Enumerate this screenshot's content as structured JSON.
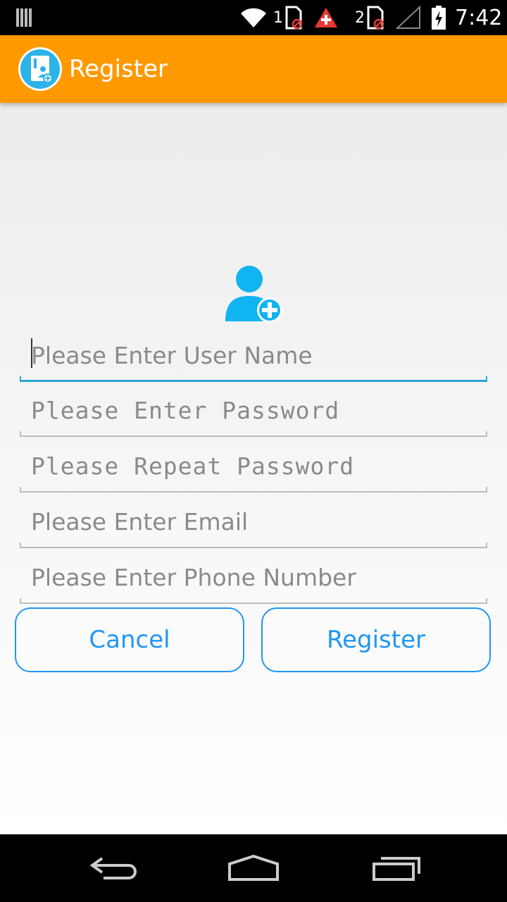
{
  "status_bar": {
    "sim1_label": "1",
    "sim2_label": "2",
    "time": "7:42",
    "icons": [
      "notification-icon",
      "wifi-icon",
      "sim1-icon",
      "alert-icon",
      "sim2-icon",
      "signal-icon",
      "battery-icon"
    ]
  },
  "app_bar": {
    "title": "Register",
    "icon": "app-logo-icon",
    "color": "#ff9900"
  },
  "form": {
    "avatar_icon": "add-user-icon",
    "username_placeholder": "Please Enter User Name",
    "password_placeholder": "Please Enter Password",
    "repeat_password_placeholder": "Please Repeat Password",
    "email_placeholder": "Please Enter Email",
    "phone_placeholder": "Please Enter Phone Number"
  },
  "buttons": {
    "cancel_label": "Cancel",
    "register_label": "Register",
    "accent": "#2196f3"
  },
  "nav_bar": {
    "icons": [
      "back-icon",
      "home-icon",
      "recents-icon"
    ]
  }
}
